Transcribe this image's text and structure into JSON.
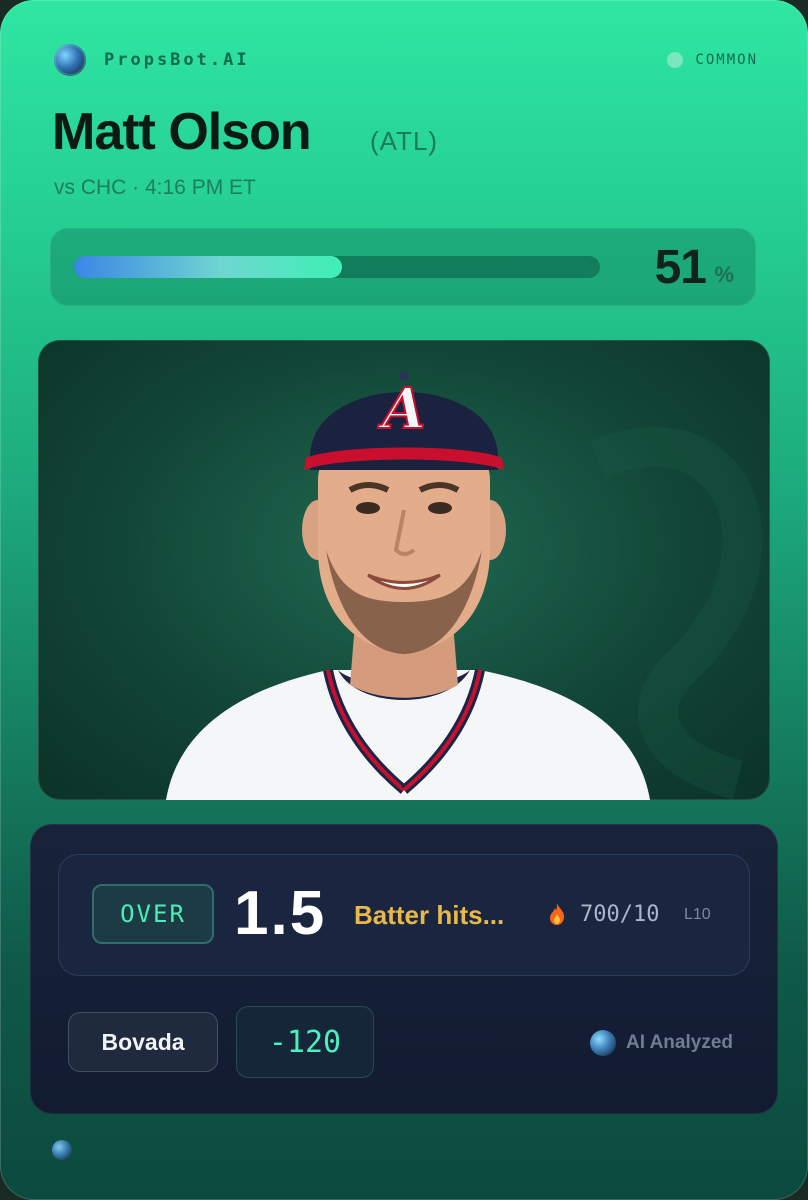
{
  "brand": {
    "name": "PropsBot.AI",
    "logo_icon": "brain-globe-icon"
  },
  "rarity": {
    "label": "COMMON",
    "color": "#8be8c4"
  },
  "player": {
    "name": "Matt Olson",
    "team": "(ATL)",
    "matchup": "vs CHC · 4:16 PM ET"
  },
  "probability": {
    "value": "51",
    "unit": "%",
    "fraction": 0.51
  },
  "prop": {
    "side": "OVER",
    "line": "1.5",
    "type": "Batter hits...",
    "streak_icon": "fire-icon",
    "streak": "700/10",
    "streak_window": "L10"
  },
  "book": {
    "name": "Bovada",
    "odds": "-120"
  },
  "analysis": {
    "label": "AI Analyzed",
    "icon": "globe-icon"
  },
  "colors": {
    "accent_green": "#46f0b8",
    "prop_type_gold": "#e8b94a",
    "panel_dark": "#121b30"
  }
}
